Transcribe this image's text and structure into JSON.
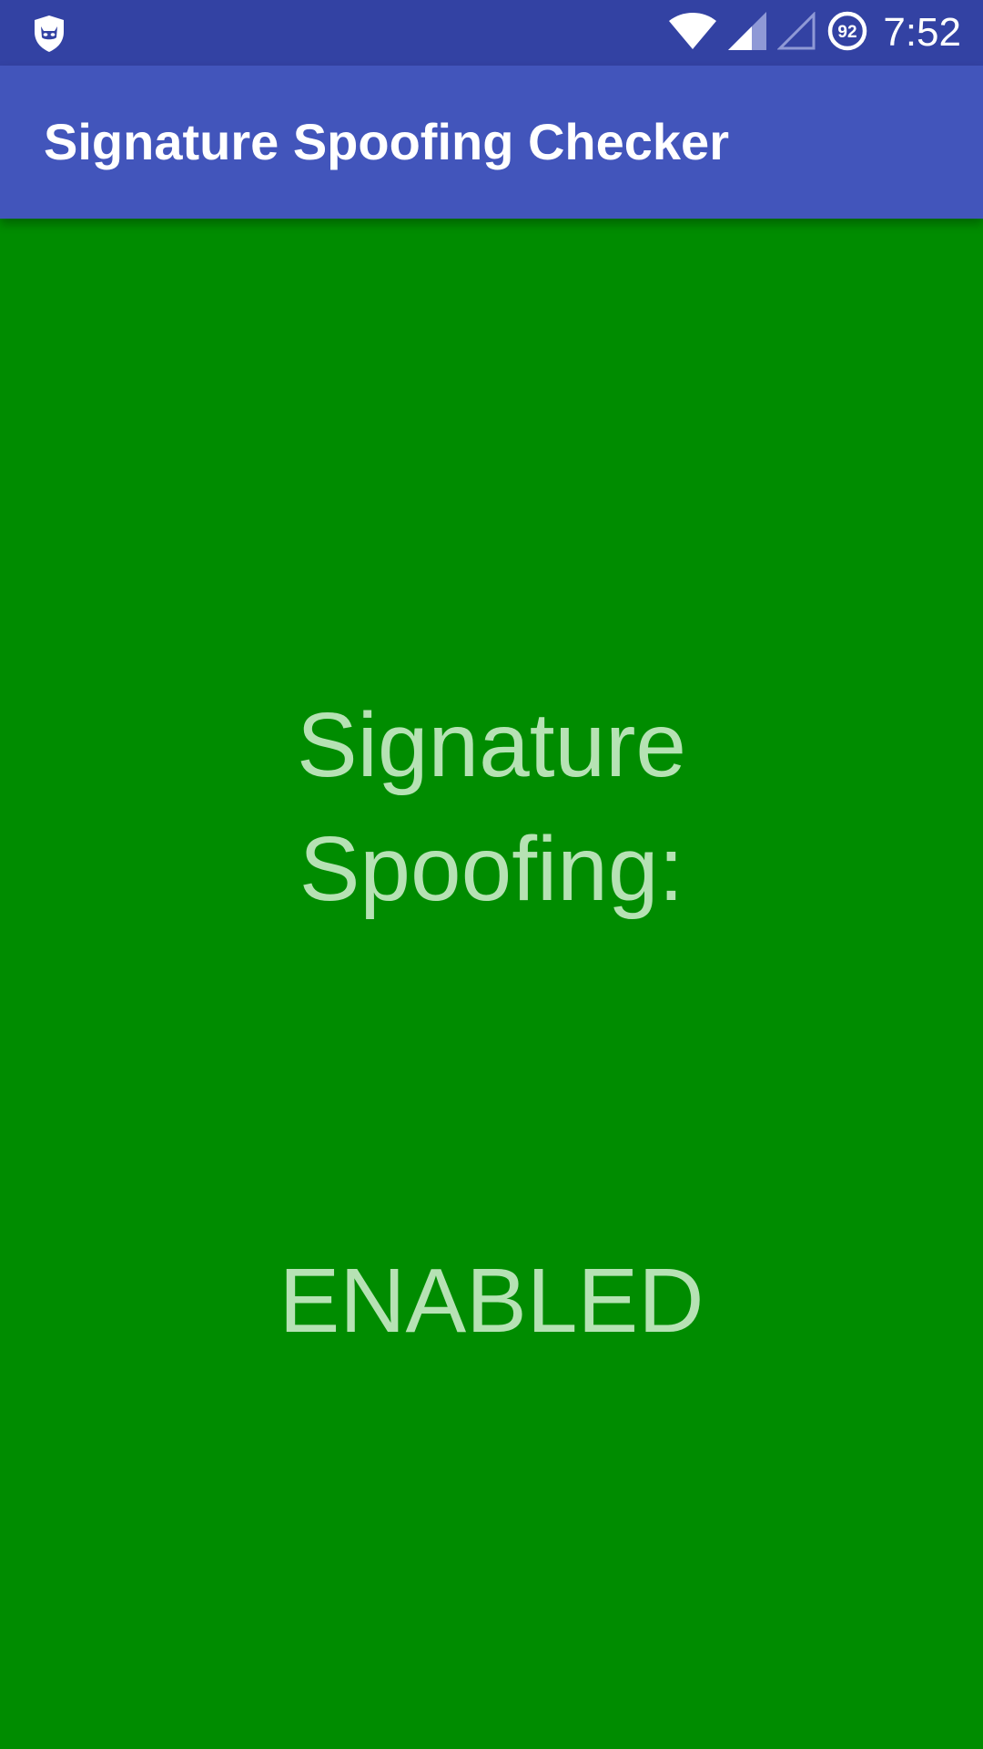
{
  "status_bar": {
    "time": "7:52",
    "battery_level": "92",
    "icons": [
      "shield-cat-icon",
      "wifi-icon",
      "cell-signal-icon",
      "cell-signal-empty-icon",
      "battery-icon"
    ]
  },
  "app_bar": {
    "title": "Signature Spoofing Checker"
  },
  "main": {
    "label_line1": "Signature",
    "label_line2": "Spoofing:",
    "state": "ENABLED"
  },
  "colors": {
    "status_bar": "#3342a3",
    "app_bar": "#4255bb",
    "background": "#008c00",
    "status_text": "#b6e2b4"
  }
}
